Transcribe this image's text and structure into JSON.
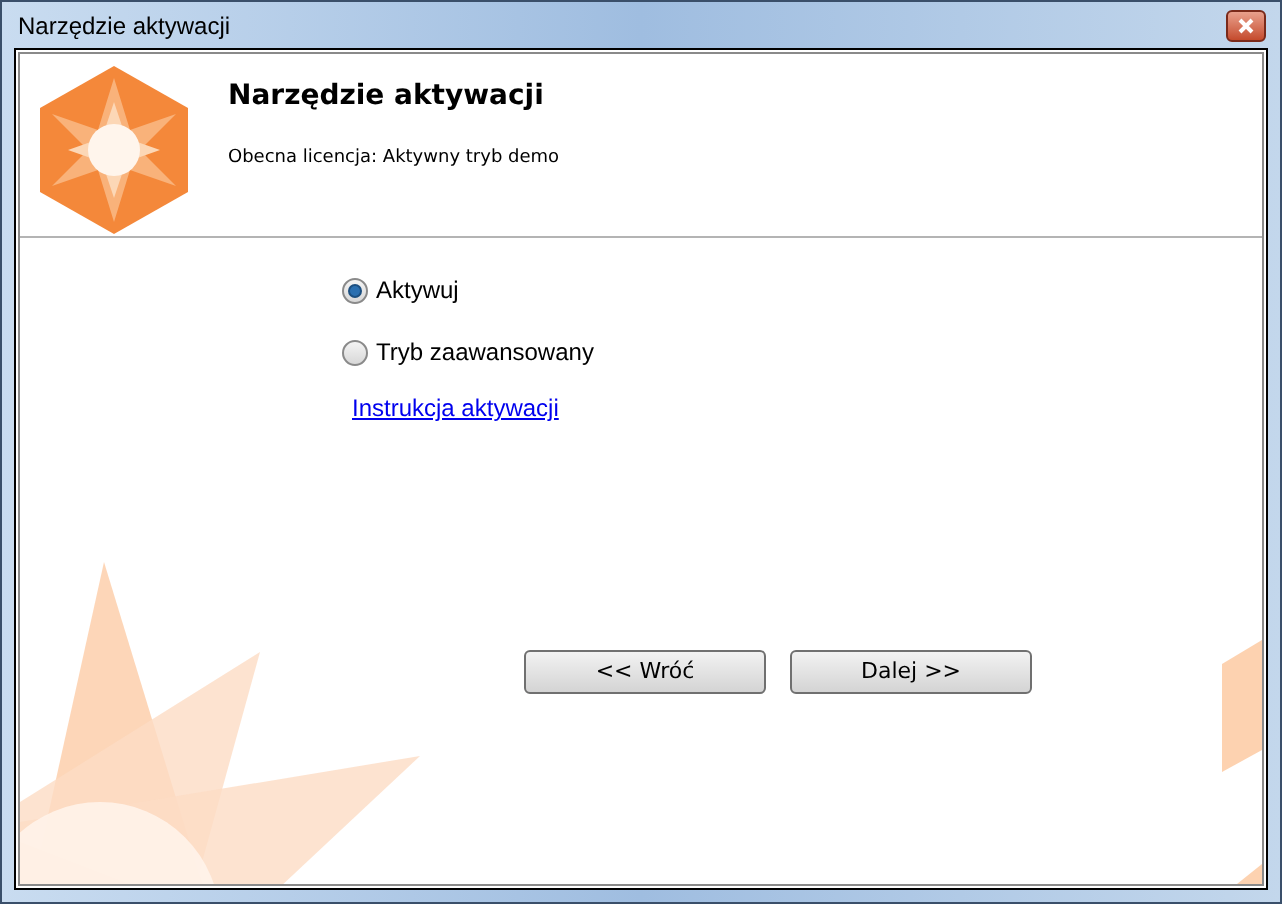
{
  "window": {
    "title": "Narzędzie aktywacji"
  },
  "header": {
    "title": "Narzędzie aktywacji",
    "subtitle": "Obecna licencja: Aktywny tryb demo"
  },
  "options": [
    {
      "label": "Aktywuj",
      "selected": true
    },
    {
      "label": "Tryb zaawansowany",
      "selected": false
    }
  ],
  "link": "Instrukcja aktywacji",
  "buttons": [
    "<< Wróć",
    "Dalej >>"
  ]
}
